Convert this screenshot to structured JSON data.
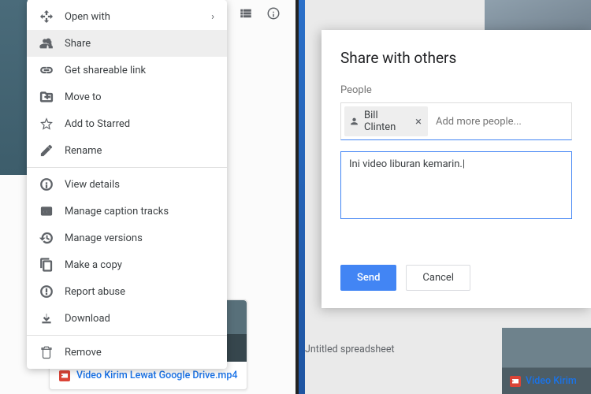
{
  "left": {
    "menu": [
      {
        "icon": "open-with",
        "label": "Open with",
        "caret": true,
        "sep": false
      },
      {
        "icon": "share",
        "label": "Share",
        "selected": true
      },
      {
        "icon": "link",
        "label": "Get shareable link"
      },
      {
        "icon": "move",
        "label": "Move to"
      },
      {
        "icon": "star",
        "label": "Add to Starred"
      },
      {
        "icon": "rename",
        "label": "Rename"
      },
      {
        "sep": true
      },
      {
        "icon": "info",
        "label": "View details"
      },
      {
        "icon": "cc",
        "label": "Manage caption tracks"
      },
      {
        "icon": "versions",
        "label": "Manage versions"
      },
      {
        "icon": "copy",
        "label": "Make a copy"
      },
      {
        "icon": "report",
        "label": "Report abuse"
      },
      {
        "icon": "download",
        "label": "Download"
      },
      {
        "sep": true
      },
      {
        "icon": "trash",
        "label": "Remove"
      }
    ],
    "file_name": "Video Kirim Lewat Google Drive.mp4"
  },
  "right": {
    "dialog": {
      "title": "Share with others",
      "people_label": "People",
      "chip_name": "Bill Clinten",
      "input_placeholder": "Add more people...",
      "message": "Ini video liburan kemarin.",
      "send": "Send",
      "cancel": "Cancel"
    },
    "bg_label_left": "Jntitled spreadsheet",
    "bg_label_right": "Video Kirim"
  }
}
